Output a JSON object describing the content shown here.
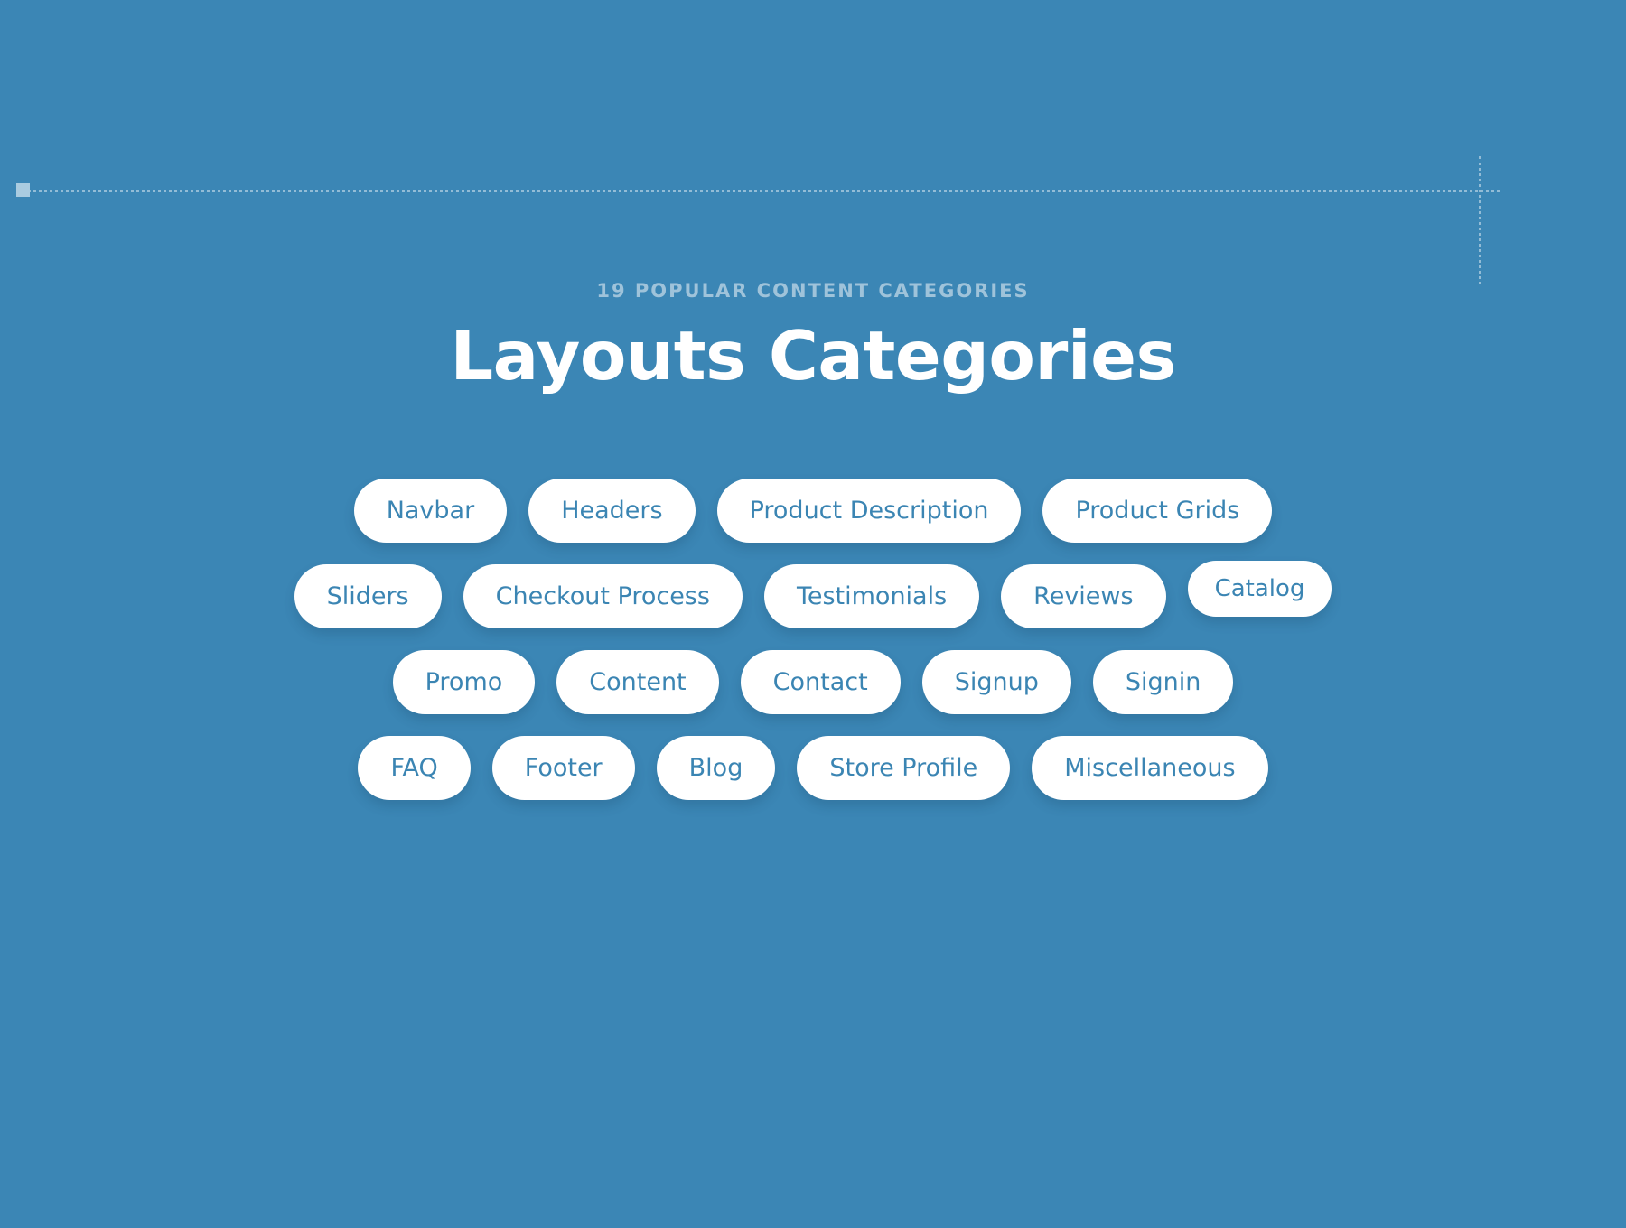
{
  "theme": {
    "background": "#3b86b5",
    "pill_background": "#ffffff",
    "pill_text": "#3b85b3",
    "title_color": "#ffffff",
    "eyebrow_color": "#9fc3da",
    "guide_color": "#a9cbe0"
  },
  "header": {
    "eyebrow": "19 POPULAR CONTENT CATEGORIES",
    "title": "Layouts Categories"
  },
  "categories": {
    "rows": [
      {
        "items": [
          {
            "label": "Navbar",
            "compact": false
          },
          {
            "label": "Headers",
            "compact": false
          },
          {
            "label": "Product Description",
            "compact": false
          },
          {
            "label": "Product Grids",
            "compact": false
          }
        ]
      },
      {
        "items": [
          {
            "label": "Sliders",
            "compact": false
          },
          {
            "label": "Checkout Process",
            "compact": false
          },
          {
            "label": "Testimonials",
            "compact": false
          },
          {
            "label": "Reviews",
            "compact": false
          },
          {
            "label": "Catalog",
            "compact": true
          }
        ]
      },
      {
        "items": [
          {
            "label": "Promo",
            "compact": false
          },
          {
            "label": "Content",
            "compact": false
          },
          {
            "label": "Contact",
            "compact": false
          },
          {
            "label": "Signup",
            "compact": false
          },
          {
            "label": "Signin",
            "compact": false
          }
        ]
      },
      {
        "items": [
          {
            "label": "FAQ",
            "compact": false
          },
          {
            "label": "Footer",
            "compact": false
          },
          {
            "label": "Blog",
            "compact": false
          },
          {
            "label": "Store Profile",
            "compact": false
          },
          {
            "label": "Miscellaneous",
            "compact": false
          }
        ]
      }
    ]
  }
}
